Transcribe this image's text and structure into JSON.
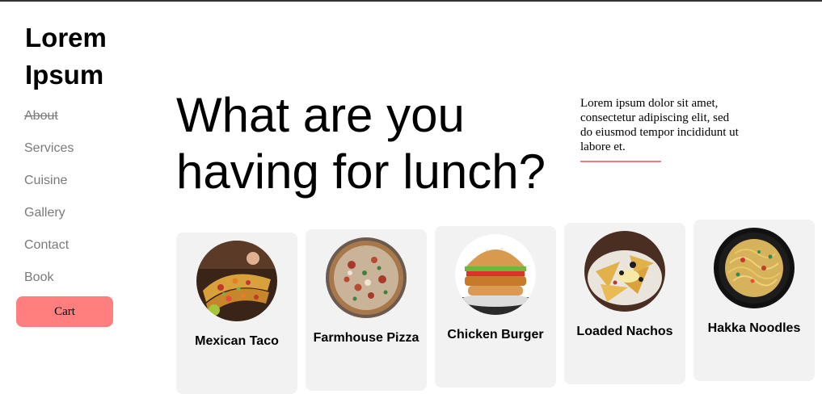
{
  "brand": {
    "title": "Lorem Ipsum"
  },
  "nav": {
    "items": [
      {
        "label": "About",
        "active": true
      },
      {
        "label": "Services"
      },
      {
        "label": "Cuisine"
      },
      {
        "label": "Gallery"
      },
      {
        "label": "Contact"
      },
      {
        "label": "Book"
      }
    ],
    "cart_label": "Cart"
  },
  "hero": {
    "heading": "What are you having for lunch?",
    "blurb": "Lorem ipsum dolor sit amet, consectetur adipiscing elit, sed do eiusmod tempor incididunt ut labore et."
  },
  "dishes": [
    {
      "name": "Mexican Taco",
      "icon": "taco-photo"
    },
    {
      "name": "Farmhouse Pizza",
      "icon": "pizza-photo"
    },
    {
      "name": "Chicken Burger",
      "icon": "burger-photo"
    },
    {
      "name": "Loaded Nachos",
      "icon": "nachos-photo"
    },
    {
      "name": "Hakka Noodles",
      "icon": "noodles-photo"
    }
  ],
  "colors": {
    "accent": "#ff7e7e",
    "card_bg": "#f2f2f2",
    "nav_text": "#7a7a7a"
  }
}
